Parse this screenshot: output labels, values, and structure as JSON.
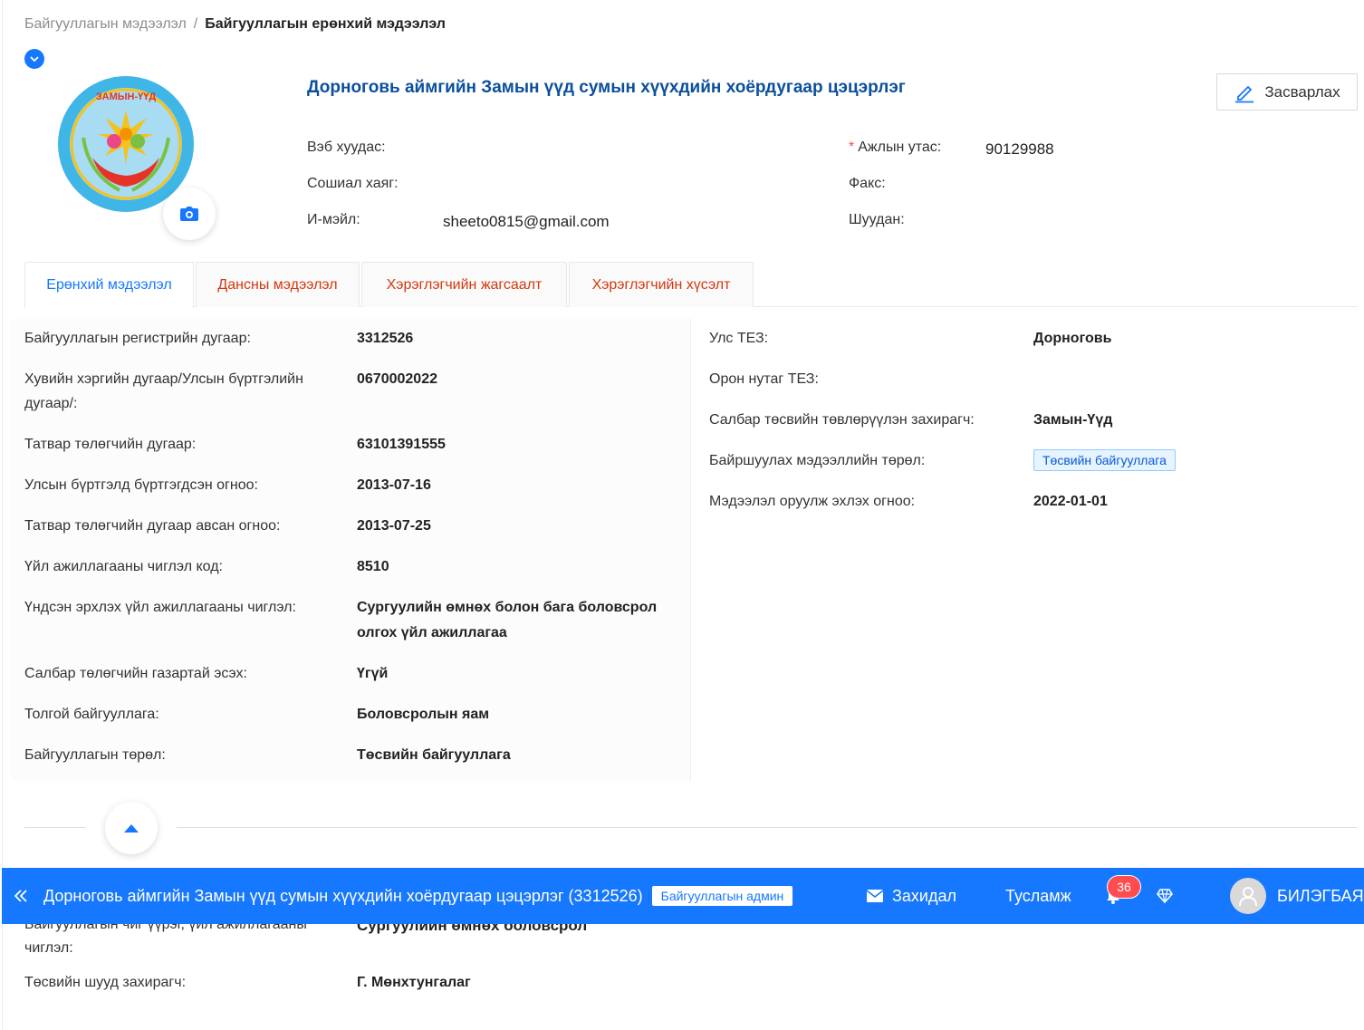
{
  "breadcrumb": {
    "parent": "Байгууллагын мэдээлэл",
    "separator": "/",
    "current": "Байгууллагын ерөнхий мэдээлэл"
  },
  "header": {
    "org_name": "Дорноговь аймгийн Замын үүд сумын хүүхдийн хоёрдугаар цэцэрлэг",
    "edit_label": "Засварлах",
    "logo_text": "ЗАМЫН-ҮҮД"
  },
  "contact": {
    "website_label": "Вэб хуудас",
    "social_label": "Сошиал хаяг",
    "email_label": "И-мэйл",
    "email_value": "sheeto0815@gmail.com",
    "required_mark": "*",
    "phone_label": "Ажлын утас",
    "phone_value": "90129988",
    "fax_label": "Факс",
    "shuudan_label": "Шуудан",
    "colon": ":"
  },
  "tabs": [
    {
      "label": "Ерөнхий мэдээлэл",
      "active": true
    },
    {
      "label": "Дансны мэдээлэл",
      "active": false
    },
    {
      "label": "Хэрэглэгчийн жагсаалт",
      "active": false
    },
    {
      "label": "Хэрэглэгчийн хүсэлт",
      "active": false
    }
  ],
  "details_left": [
    {
      "label": "Байгууллагын регистрийн дугаар:",
      "value": "3312526"
    },
    {
      "label": "Хувийн хэргийн дугаар/Улсын бүртгэлийн дугаар/:",
      "value": "0670002022"
    },
    {
      "label": "Татвар төлөгчийн дугаар:",
      "value": "63101391555"
    },
    {
      "label": "Улсын бүртгэлд бүртгэгдсэн огноо:",
      "value": "2013-07-16"
    },
    {
      "label": "Татвар төлөгчийн дугаар авсан огноо:",
      "value": "2013-07-25"
    },
    {
      "label": "Үйл ажиллагааны чиглэл код:",
      "value": "8510"
    },
    {
      "label": "Үндсэн эрхлэх үйл ажиллагааны чиглэл:",
      "value": "Сургуулийн өмнөх болон бага боловсрол олгох үйл ажиллагаа"
    },
    {
      "label": "Салбар төлөгчийн газартай эсэх:",
      "value": "Үгүй"
    },
    {
      "label": "Толгой байгууллага:",
      "value": "Боловсролын яам"
    },
    {
      "label": "Байгууллагын төрөл:",
      "value": "Төсвийн байгууллага"
    }
  ],
  "details_right": [
    {
      "label": "Улс ТЕЗ:",
      "value": "Дорноговь"
    },
    {
      "label": "Орон нутаг ТЕЗ:",
      "value": ""
    },
    {
      "label": "Салбар төсвийн төвлөрүүлэн захирагч:",
      "value": "Замын-Үүд"
    },
    {
      "label": "Байршуулах мэдээллийн төрөл:",
      "badge": "Төсвийн байгууллага"
    },
    {
      "label": "Мэдээлэл оруулж эхлэх огноо:",
      "value": "2022-01-01"
    }
  ],
  "bottom_bar": {
    "org_text": "Дорноговь аймгийн Замын үүд сумын хүүхдийн хоёрдугаар цэцэрлэг (3312526)",
    "role_badge": "Байгууллагын админ",
    "mail_label": "Захидал",
    "help_label": "Тусламж",
    "notification_count": "36",
    "user_name": "БИЛЭГБАЯР"
  },
  "below_section": {
    "partial_label": "Байгууллагын чиг үүрэг, үйл ажиллагааны",
    "partial_value": "Сургуулийн өмнөх боловсрол",
    "label_cont": "чиглэл",
    "manager_label": "Төсвийн шууд захирагч",
    "manager_value": "Г. Мөнхтунгалаг"
  },
  "colors": {
    "primary": "#1677ff",
    "title": "#0b4f9c",
    "tab_inactive": "#d4380d",
    "danger": "#ff4d4f"
  }
}
